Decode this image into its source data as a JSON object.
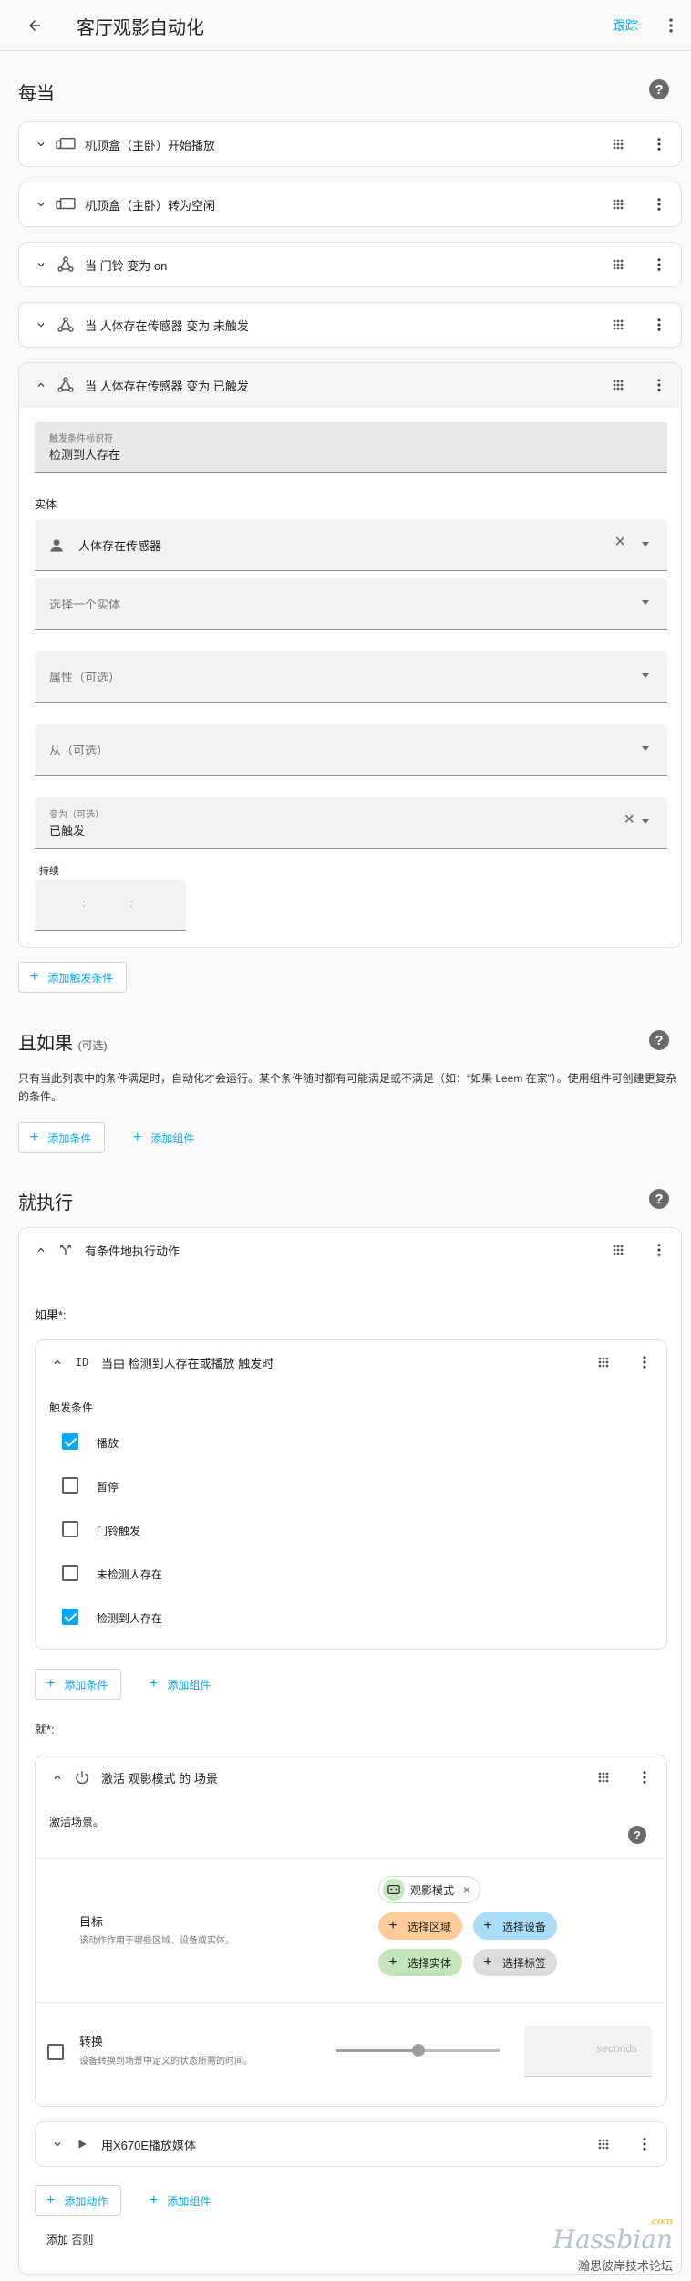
{
  "header": {
    "title": "客厅观影自动化",
    "trace": "跟踪"
  },
  "triggers": {
    "title": "每当",
    "items": [
      {
        "label": "机顶盒（主卧）开始播放"
      },
      {
        "label": "机顶盒（主卧）转为空闲"
      },
      {
        "label": "当 门铃 变为 on"
      },
      {
        "label": "当 人体存在传感器 变为 未触发"
      },
      {
        "label": "当 人体存在传感器 变为 已触发"
      }
    ],
    "expanded": {
      "id_label": "触发条件标识符",
      "id_value": "检测到人存在",
      "entity_section": "实体",
      "entity_value": "人体存在传感器",
      "entity_placeholder": "选择一个实体",
      "attribute_placeholder": "属性（可选）",
      "from_placeholder": "从（可选）",
      "to_label": "变为（可选）",
      "to_value": "已触发",
      "duration_label": "持续",
      "duration_sep1": ":",
      "duration_sep2": ":"
    },
    "add_button": "添加触发条件"
  },
  "conditions": {
    "title": "且如果",
    "optional": "(可选)",
    "description": "只有当此列表中的条件满足时，自动化才会运行。某个条件随时都有可能满足或不满足（如：“如果 Leem 在家”）。使用组件可创建更复杂的条件。",
    "add_condition": "添加条件",
    "add_block": "添加组件"
  },
  "actions": {
    "title": "就执行",
    "choose": {
      "label": "有条件地执行动作",
      "if_label": "如果*:",
      "trigger_cond": {
        "id_tag": "ID",
        "label": "当由 检测到人存在或播放 触发时",
        "section": "触发条件",
        "options": [
          {
            "label": "播放",
            "checked": true
          },
          {
            "label": "暂停",
            "checked": false
          },
          {
            "label": "门铃触发",
            "checked": false
          },
          {
            "label": "未检测人存在",
            "checked": false
          },
          {
            "label": "检测到人存在",
            "checked": true
          }
        ]
      },
      "add_condition": "添加条件",
      "add_block": "添加组件",
      "then_label": "就*:",
      "scene": {
        "label": "激活 观影模式 的 场景",
        "description": "激活场景。",
        "target_title": "目标",
        "target_desc": "该动作作用于哪些区域、设备或实体。",
        "target_chip": "观影模式",
        "chips": [
          {
            "label": "选择区域",
            "color": "#ffcc99"
          },
          {
            "label": "选择设备",
            "color": "#a9dcf7"
          },
          {
            "label": "选择实体",
            "color": "#c5e6bd"
          },
          {
            "label": "选择标签",
            "color": "#dcdcdc"
          }
        ],
        "transition_title": "转换",
        "transition_desc": "设备转换到场景中定义的状态所需的时间。",
        "transition_unit": "seconds",
        "transition_level": 0.5
      },
      "media": {
        "label": "用X670E播放媒体"
      },
      "add_action": "添加动作",
      "add_block2": "添加组件",
      "add_else": "添加 否则"
    }
  },
  "watermark": {
    "brand": "Hassbian",
    "domain": ".com",
    "subtitle": "瀚思彼岸技术论坛"
  }
}
